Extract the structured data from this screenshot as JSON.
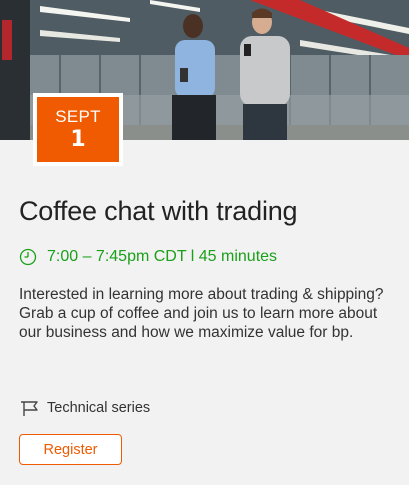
{
  "event": {
    "date": {
      "month": "SEPT",
      "day": "1"
    },
    "title": "Coffee chat with trading",
    "time": "7:00 – 7:45pm CDT l 45 minutes",
    "description": "Interested in learning more about trading & shipping? Grab a cup of coffee and join us to learn more about our business and how we maximize value for bp.",
    "series": "Technical series",
    "register_label": "Register"
  },
  "icons": {
    "time": "clock-icon",
    "series": "flag-icon"
  },
  "colors": {
    "accent": "#f05a00",
    "time_text": "#1aa01a",
    "card_background": "#f2f2f2"
  }
}
